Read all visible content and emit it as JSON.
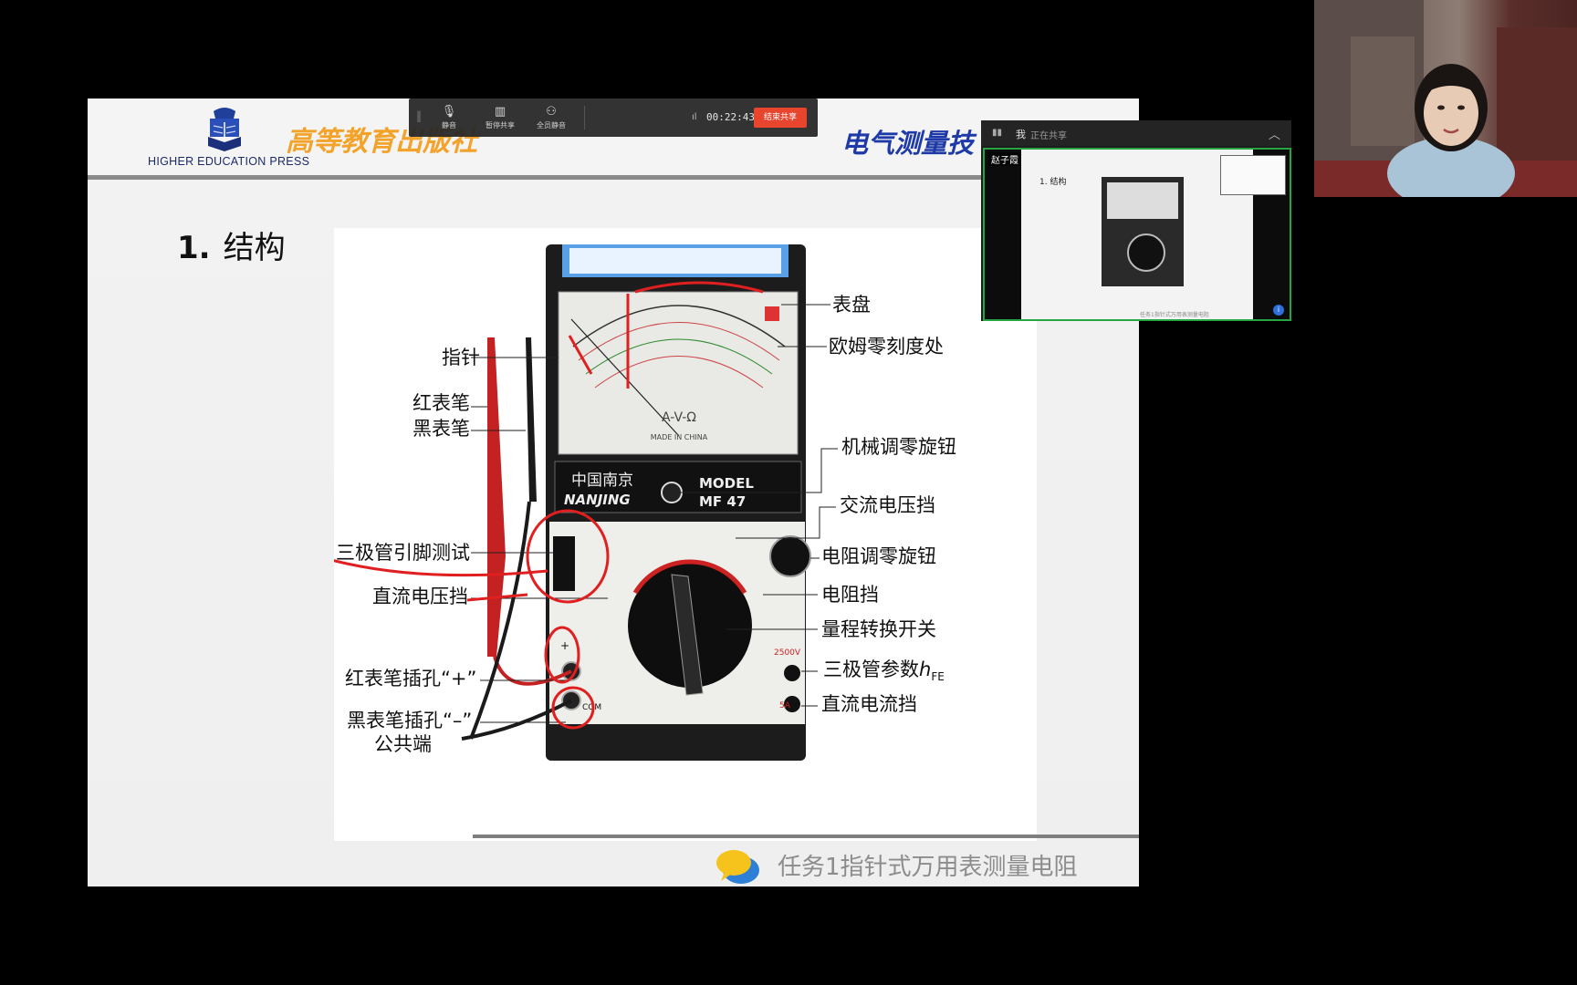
{
  "slide": {
    "publisher_logo_text": "HIGHER EDUCATION PRESS",
    "publisher_title": "高等教育出版社",
    "course_title": "电气测量技",
    "section_number": "1.",
    "section_title": "结构",
    "footer_text": "任务1指针式万用表测量电阻",
    "callouts": {
      "dial": "表盘",
      "ohm_zero": "欧姆零刻度处",
      "pointer": "指针",
      "red_probe": "红表笔",
      "black_probe": "黑表笔",
      "mech_zero_knob": "机械调零旋钮",
      "ac_voltage": "交流电压挡",
      "transistor_pin_test": "三极管引脚测试",
      "resistance_zero_knob": "电阻调零旋钮",
      "dc_voltage": "直流电压挡",
      "resistance": "电阻挡",
      "range_switch": "量程转换开关",
      "transistor_param_prefix": "三极管参数",
      "transistor_param_h": "h",
      "transistor_param_sub": "FE",
      "red_jack": "红表笔插孔“+”",
      "black_jack_line1": "黑表笔插孔“–”",
      "black_jack_line2": "公共端",
      "dc_current": "直流电流挡"
    },
    "meter_labels": {
      "brand": "中国南京",
      "brand_latin": "NANJING",
      "model": "MODEL",
      "model_number": "MF 47",
      "face_symbol": "A-V-Ω",
      "made_in": "MADE IN CHINA",
      "com": "COM",
      "plus": "+",
      "range_2500v": "2500V",
      "range_5a": "5A"
    }
  },
  "toolbar": {
    "grip": "‖",
    "mute_label": "静音",
    "pause_share_label": "暂停共享",
    "mute_all_label": "全员静音",
    "signal": "ıl",
    "timer": "00:22:43",
    "end_share_label": "结束共享"
  },
  "preview": {
    "me_label": "我",
    "status": "正在共享",
    "collapse": "︿",
    "participant_name": "赵子霞",
    "slide_title": "1. 结构",
    "footer": "任务1指针式万用表测量电阻",
    "badge": "i"
  },
  "colors": {
    "publisher_orange": "#f3a22a",
    "course_blue": "#1e3aa8",
    "end_share_red": "#e8452e",
    "active_speaker_green": "#27a544",
    "annotation_red": "#e02020"
  },
  "icons": {
    "mute": "microphone-icon",
    "pause_share": "pause-share-icon",
    "mute_all": "mute-all-icon",
    "signal": "signal-bars-icon",
    "collapse": "chevron-up-icon",
    "footer": "speech-bubble-icon"
  }
}
